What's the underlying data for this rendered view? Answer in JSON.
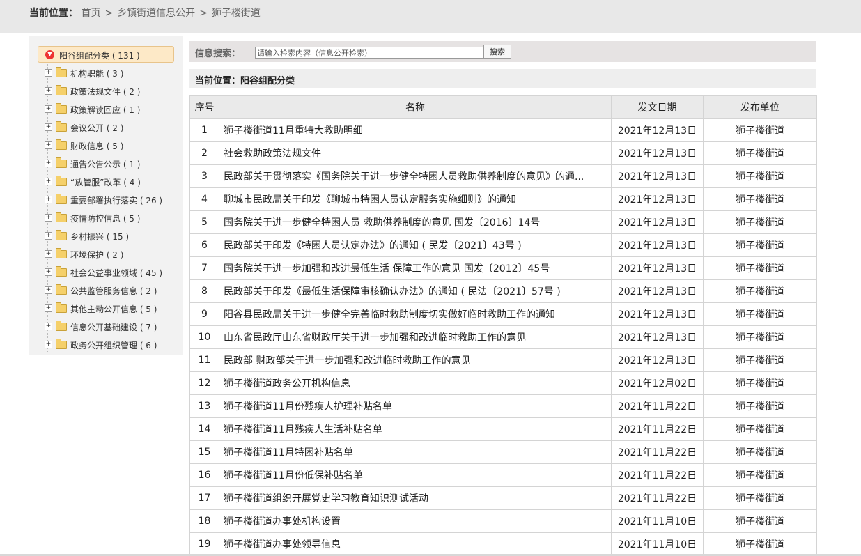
{
  "breadcrumb": {
    "label": "当前位置：",
    "items": [
      "首页",
      "乡镇街道信息公开",
      "狮子楼街道"
    ]
  },
  "sidebar": {
    "root": "阳谷组配分类 ( 131 )",
    "items": [
      {
        "label": "机构职能 ( 3 )"
      },
      {
        "label": "政策法规文件 ( 2 )"
      },
      {
        "label": "政策解读回应 ( 1 )"
      },
      {
        "label": "会议公开 ( 2 )"
      },
      {
        "label": "财政信息 ( 5 )"
      },
      {
        "label": "通告公告公示 ( 1 )"
      },
      {
        "label": "“放管服”改革 ( 4 )"
      },
      {
        "label": "重要部署执行落实 ( 26 )"
      },
      {
        "label": "疫情防控信息 ( 5 )"
      },
      {
        "label": "乡村振兴 ( 15 )"
      },
      {
        "label": "环境保护 ( 2 )"
      },
      {
        "label": "社会公益事业领域 ( 45 )"
      },
      {
        "label": "公共监管服务信息 ( 2 )"
      },
      {
        "label": "其他主动公开信息 ( 5 )"
      },
      {
        "label": "信息公开基础建设 ( 7 )"
      },
      {
        "label": "政务公开组织管理 ( 6 )"
      }
    ]
  },
  "search": {
    "label": "信息搜索：",
    "placeholder": "请输入检索内容（信息公开检索）",
    "button": "搜索"
  },
  "current": {
    "text": "当前位置：阳谷组配分类"
  },
  "table": {
    "headers": [
      "序号",
      "名称",
      "发文日期",
      "发布单位"
    ],
    "rows": [
      {
        "no": "1",
        "title": "狮子楼街道11月重特大救助明细",
        "date": "2021年12月13日",
        "unit": "狮子楼街道"
      },
      {
        "no": "2",
        "title": "社会救助政策法规文件",
        "date": "2021年12月13日",
        "unit": "狮子楼街道"
      },
      {
        "no": "3",
        "title": "民政部关于贯彻落实《国务院关于进一步健全特困人员救助供养制度的意见》的通...",
        "date": "2021年12月13日",
        "unit": "狮子楼街道"
      },
      {
        "no": "4",
        "title": "聊城市民政局关于印发《聊城市特困人员认定服务实施细则》的通知",
        "date": "2021年12月13日",
        "unit": "狮子楼街道"
      },
      {
        "no": "5",
        "title": "国务院关于进一步健全特困人员 救助供养制度的意见 国发〔2016〕14号",
        "date": "2021年12月13日",
        "unit": "狮子楼街道"
      },
      {
        "no": "6",
        "title": "民政部关于印发《特困人员认定办法》的通知 ( 民发〔2021〕43号 )",
        "date": "2021年12月13日",
        "unit": "狮子楼街道"
      },
      {
        "no": "7",
        "title": "国务院关于进一步加强和改进最低生活 保障工作的意见 国发〔2012〕45号",
        "date": "2021年12月13日",
        "unit": "狮子楼街道"
      },
      {
        "no": "8",
        "title": "民政部关于印发《最低生活保障审核确认办法》的通知 ( 民法〔2021〕57号 )",
        "date": "2021年12月13日",
        "unit": "狮子楼街道"
      },
      {
        "no": "9",
        "title": "阳谷县民政局关于进一步健全完善临时救助制度切实做好临时救助工作的通知",
        "date": "2021年12月13日",
        "unit": "狮子楼街道"
      },
      {
        "no": "10",
        "title": "山东省民政厅山东省财政厅关于进一步加强和改进临时救助工作的意见",
        "date": "2021年12月13日",
        "unit": "狮子楼街道"
      },
      {
        "no": "11",
        "title": "民政部 财政部关于进一步加强和改进临时救助工作的意见",
        "date": "2021年12月13日",
        "unit": "狮子楼街道"
      },
      {
        "no": "12",
        "title": "狮子楼街道政务公开机构信息",
        "date": "2021年12月02日",
        "unit": "狮子楼街道"
      },
      {
        "no": "13",
        "title": "狮子楼街道11月份残疾人护理补贴名单",
        "date": "2021年11月22日",
        "unit": "狮子楼街道"
      },
      {
        "no": "14",
        "title": "狮子楼街道11月残疾人生活补贴名单",
        "date": "2021年11月22日",
        "unit": "狮子楼街道"
      },
      {
        "no": "15",
        "title": "狮子楼街道11月特困补贴名单",
        "date": "2021年11月22日",
        "unit": "狮子楼街道"
      },
      {
        "no": "16",
        "title": "狮子楼街道11月份低保补贴名单",
        "date": "2021年11月22日",
        "unit": "狮子楼街道"
      },
      {
        "no": "17",
        "title": "狮子楼街道组织开展党史学习教育知识测试活动",
        "date": "2021年11月22日",
        "unit": "狮子楼街道"
      },
      {
        "no": "18",
        "title": "狮子楼街道办事处机构设置",
        "date": "2021年11月10日",
        "unit": "狮子楼街道"
      },
      {
        "no": "19",
        "title": "狮子楼街道办事处领导信息",
        "date": "2021年11月10日",
        "unit": "狮子楼街道"
      }
    ]
  }
}
